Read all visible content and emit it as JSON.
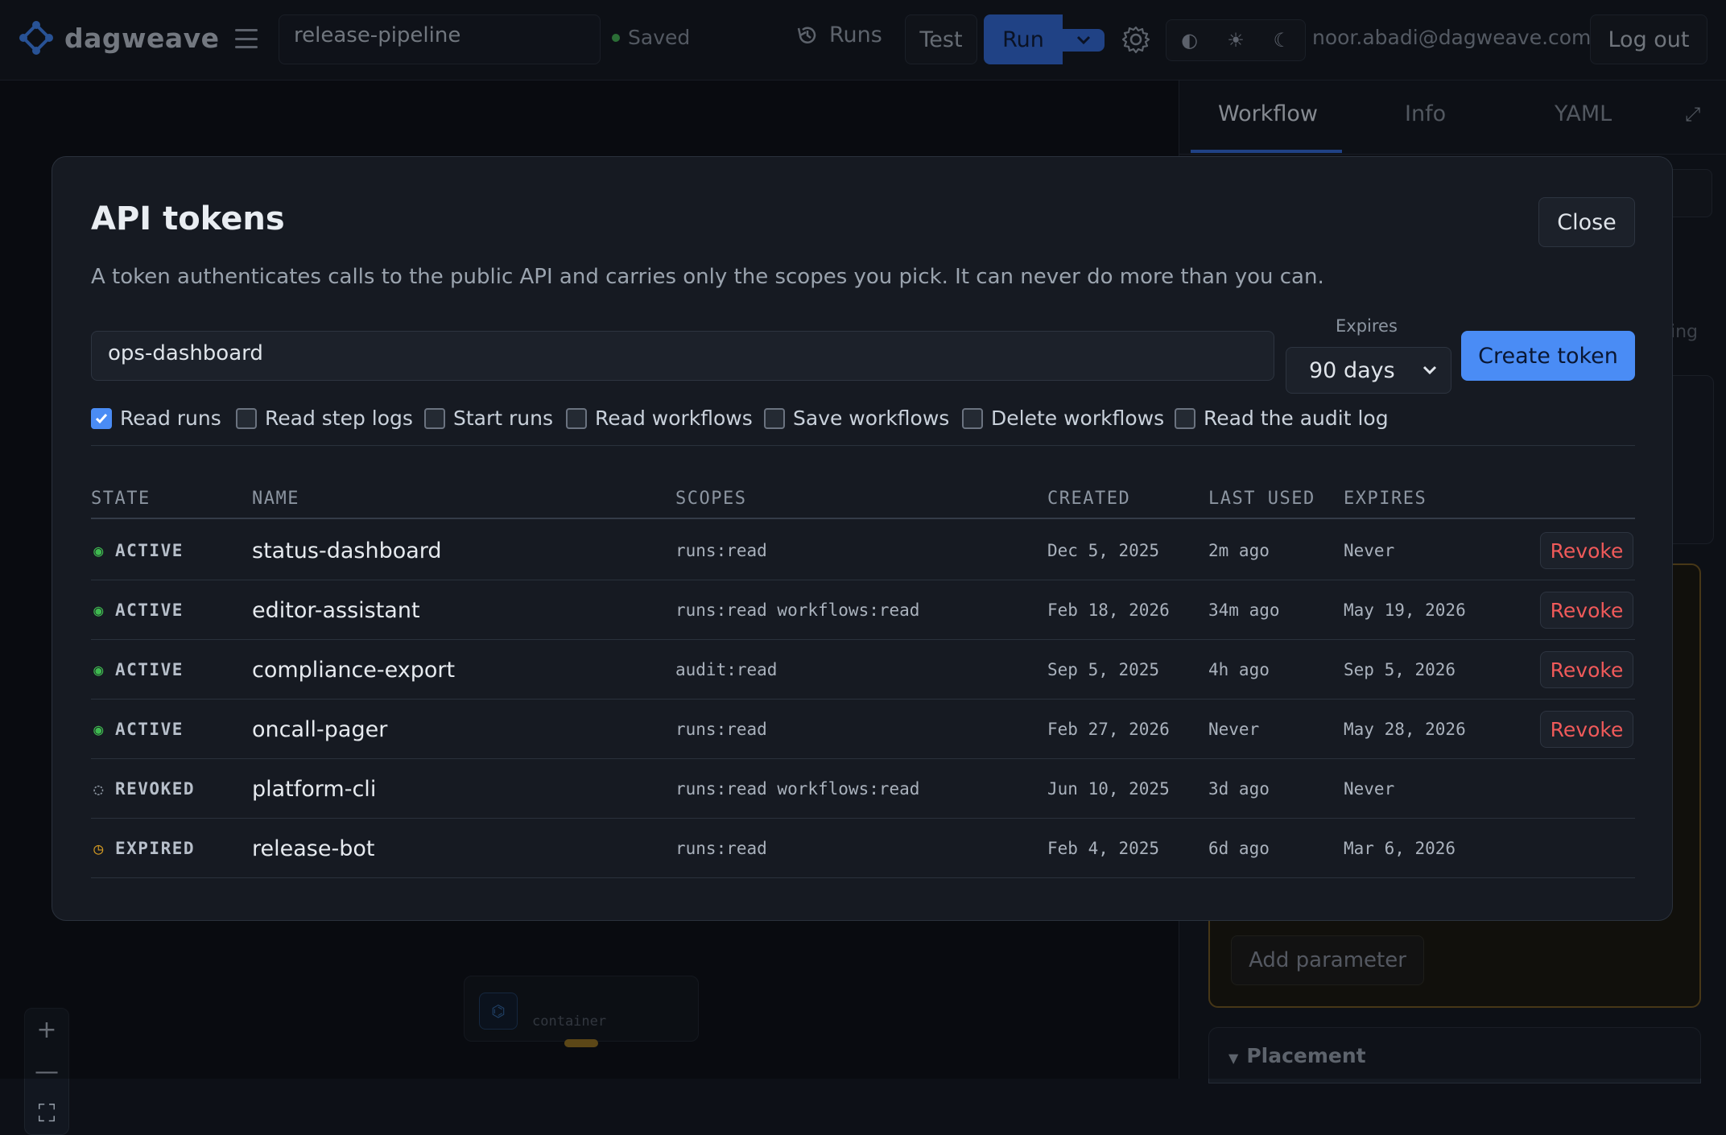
{
  "topbar": {
    "app_name": "dagweave",
    "workflow_name": "release-pipeline",
    "saved_label": "Saved",
    "runs_label": "Runs",
    "test_label": "Test",
    "run_label": "Run",
    "theme_icons": [
      "contrast-icon",
      "sun-icon",
      "moon-icon"
    ],
    "user_email": "noor.abadi@dagweave.com",
    "logout_label": "Log out"
  },
  "right_panel": {
    "tabs": [
      "Workflow",
      "Info",
      "YAML"
    ],
    "active_tab": "Workflow",
    "fragment_text": "ing",
    "add_parameter_label": "Add parameter",
    "placement_label": "Placement"
  },
  "canvas": {
    "node_type": "container"
  },
  "modal": {
    "title": "API tokens",
    "close_label": "Close",
    "description": "A token authenticates calls to the public API and carries only the scopes you pick. It can never do more than you can.",
    "token_name_value": "ops-dashboard",
    "expires_label": "Expires",
    "expires_value": "90 days",
    "create_label": "Create token",
    "scopes": [
      {
        "label": "Read runs",
        "checked": true
      },
      {
        "label": "Read step logs",
        "checked": false
      },
      {
        "label": "Start runs",
        "checked": false
      },
      {
        "label": "Read workflows",
        "checked": false
      },
      {
        "label": "Save workflows",
        "checked": false
      },
      {
        "label": "Delete workflows",
        "checked": false
      },
      {
        "label": "Read the audit log",
        "checked": false
      }
    ],
    "columns": [
      "STATE",
      "NAME",
      "SCOPES",
      "CREATED",
      "LAST USED",
      "EXPIRES"
    ],
    "tokens": [
      {
        "state": "ACTIVE",
        "name": "status-dashboard",
        "scopes": "runs:read",
        "created": "Dec 5, 2025",
        "last_used": "2m ago",
        "expires": "Never",
        "action": "Revoke"
      },
      {
        "state": "ACTIVE",
        "name": "editor-assistant",
        "scopes": "runs:read workflows:read",
        "created": "Feb 18, 2026",
        "last_used": "34m ago",
        "expires": "May 19, 2026",
        "action": "Revoke"
      },
      {
        "state": "ACTIVE",
        "name": "compliance-export",
        "scopes": "audit:read",
        "created": "Sep 5, 2025",
        "last_used": "4h ago",
        "expires": "Sep 5, 2026",
        "action": "Revoke"
      },
      {
        "state": "ACTIVE",
        "name": "oncall-pager",
        "scopes": "runs:read",
        "created": "Feb 27, 2026",
        "last_used": "Never",
        "expires": "May 28, 2026",
        "action": "Revoke"
      },
      {
        "state": "REVOKED",
        "name": "platform-cli",
        "scopes": "runs:read workflows:read",
        "created": "Jun 10, 2025",
        "last_used": "3d ago",
        "expires": "Never",
        "action": ""
      },
      {
        "state": "EXPIRED",
        "name": "release-bot",
        "scopes": "runs:read",
        "created": "Feb 4, 2025",
        "last_used": "6d ago",
        "expires": "Mar 6, 2026",
        "action": ""
      }
    ],
    "state_colors": {
      "ACTIVE": "#3fb950",
      "REVOKED": "#8c95a1",
      "EXPIRED": "#d29922"
    }
  }
}
